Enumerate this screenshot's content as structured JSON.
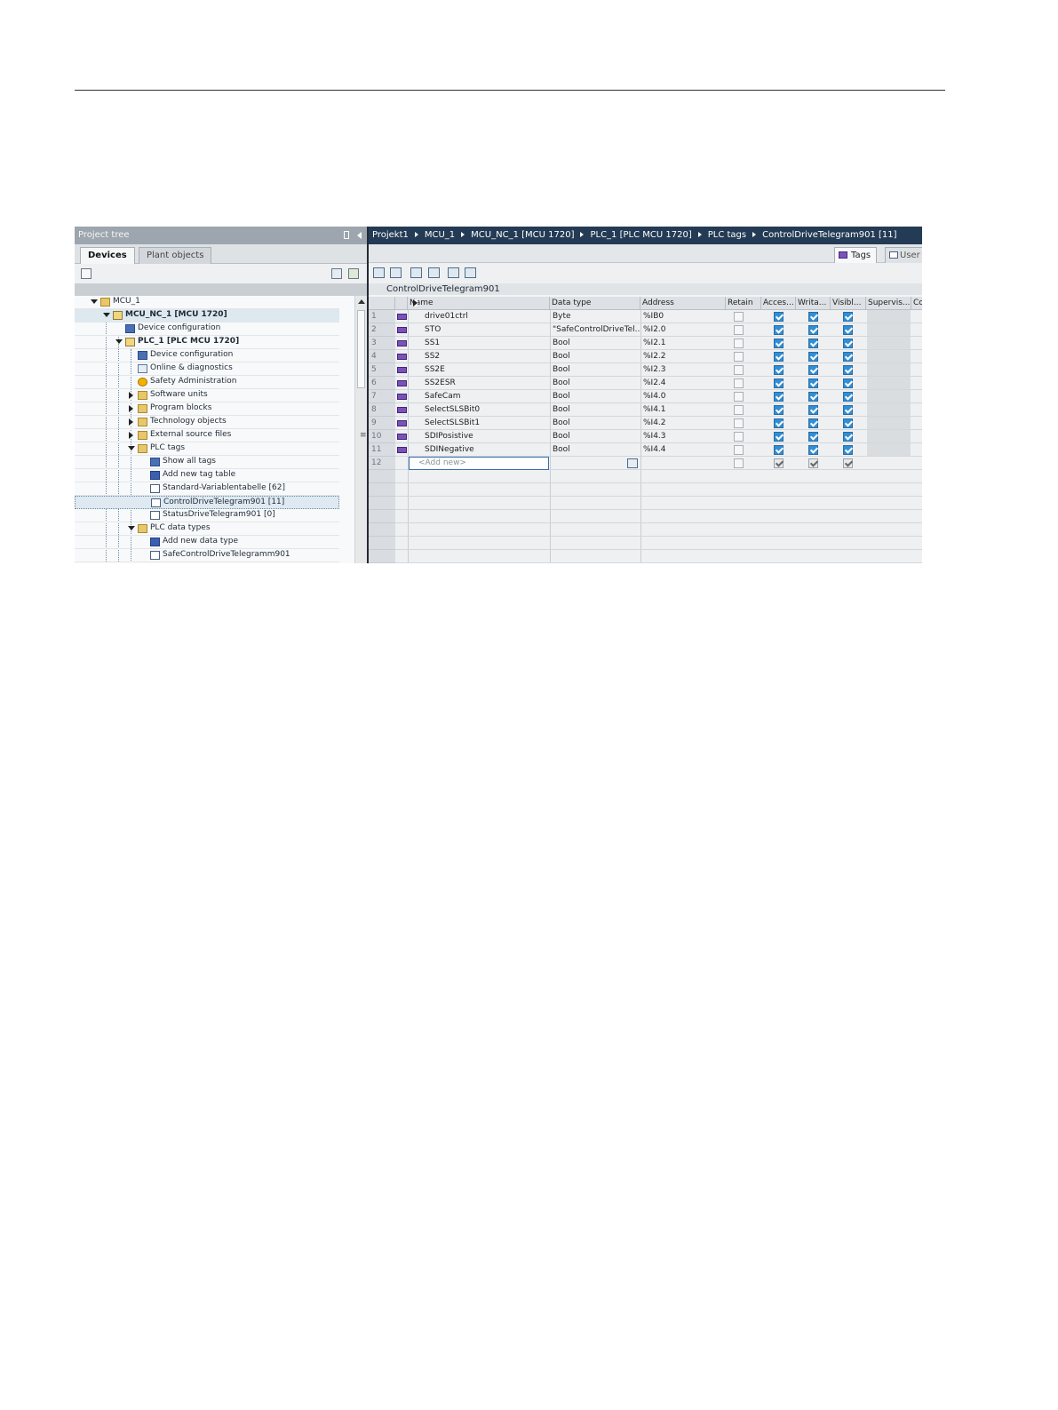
{
  "left_panel": {
    "title": "Project tree",
    "tabs": [
      "Devices",
      "Plant objects"
    ],
    "tree": [
      {
        "label": "MCU_1",
        "level": 0,
        "expander": "down",
        "icon": "folder-icon",
        "bold": false
      },
      {
        "label": "MCU_NC_1 [MCU 1720]",
        "level": 1,
        "expander": "down",
        "icon": "plc-icon",
        "bold": true
      },
      {
        "label": "Device configuration",
        "level": 2,
        "expander": "none",
        "icon": "device-config-icon",
        "bold": false
      },
      {
        "label": "PLC_1 [PLC MCU 1720]",
        "level": 2,
        "expander": "down",
        "icon": "plc-icon",
        "bold": true
      },
      {
        "label": "Device configuration",
        "level": 3,
        "expander": "none",
        "icon": "device-config-icon",
        "bold": false
      },
      {
        "label": "Online & diagnostics",
        "level": 3,
        "expander": "none",
        "icon": "diagnostics-icon",
        "bold": false
      },
      {
        "label": "Safety Administration",
        "level": 3,
        "expander": "none",
        "icon": "safety-icon",
        "bold": false
      },
      {
        "label": "Software units",
        "level": 3,
        "expander": "right",
        "icon": "folder-icon",
        "bold": false
      },
      {
        "label": "Program blocks",
        "level": 3,
        "expander": "right",
        "icon": "folder-icon",
        "bold": false
      },
      {
        "label": "Technology objects",
        "level": 3,
        "expander": "right",
        "icon": "folder-icon",
        "bold": false
      },
      {
        "label": "External source files",
        "level": 3,
        "expander": "right",
        "icon": "folder-icon",
        "bold": false
      },
      {
        "label": "PLC tags",
        "level": 3,
        "expander": "down",
        "icon": "folder-icon",
        "bold": false
      },
      {
        "label": "Show all tags",
        "level": 4,
        "expander": "none",
        "icon": "show-tags-icon",
        "bold": false
      },
      {
        "label": "Add new tag table",
        "level": 4,
        "expander": "none",
        "icon": "add-icon",
        "bold": false
      },
      {
        "label": "Standard-Variablentabelle [62]",
        "level": 4,
        "expander": "none",
        "icon": "tag-table-icon",
        "bold": false
      },
      {
        "label": "ControlDriveTelegram901 [11]",
        "level": 4,
        "expander": "none",
        "icon": "tag-table-icon",
        "bold": false
      },
      {
        "label": "StatusDriveTelegram901 [0]",
        "level": 4,
        "expander": "none",
        "icon": "tag-table-icon",
        "bold": false
      },
      {
        "label": "PLC data types",
        "level": 3,
        "expander": "down",
        "icon": "folder-icon",
        "bold": false
      },
      {
        "label": "Add new data type",
        "level": 4,
        "expander": "none",
        "icon": "add-icon",
        "bold": false
      },
      {
        "label": "SafeControlDriveTelegramm901",
        "level": 4,
        "expander": "none",
        "icon": "data-type-icon",
        "bold": false
      }
    ]
  },
  "breadcrumb": [
    "Projekt1",
    "MCU_1",
    "MCU_NC_1 [MCU 1720]",
    "PLC_1 [PLC MCU 1720]",
    "PLC tags",
    "ControlDriveTelegram901 [11]"
  ],
  "view_tabs": [
    "Tags",
    "User"
  ],
  "table": {
    "title": "ControlDriveTelegram901",
    "columns": [
      "Name",
      "Data type",
      "Address",
      "Retain",
      "Acces...",
      "Writa...",
      "Visibl...",
      "Supervis...",
      "Co"
    ],
    "rows": [
      {
        "num": "1",
        "name": "drive01ctrl",
        "type": "Byte",
        "address": "%IB0",
        "expander": false
      },
      {
        "num": "2",
        "name": "STO",
        "type": "\"SafeControlDriveTel...",
        "address": "%I2.0",
        "expander": true
      },
      {
        "num": "3",
        "name": "SS1",
        "type": "Bool",
        "address": "%I2.1",
        "expander": false
      },
      {
        "num": "4",
        "name": "SS2",
        "type": "Bool",
        "address": "%I2.2",
        "expander": false
      },
      {
        "num": "5",
        "name": "SS2E",
        "type": "Bool",
        "address": "%I2.3",
        "expander": false
      },
      {
        "num": "6",
        "name": "SS2ESR",
        "type": "Bool",
        "address": "%I2.4",
        "expander": false
      },
      {
        "num": "7",
        "name": "SafeCam",
        "type": "Bool",
        "address": "%I4.0",
        "expander": false
      },
      {
        "num": "8",
        "name": "SelectSLSBit0",
        "type": "Bool",
        "address": "%I4.1",
        "expander": false
      },
      {
        "num": "9",
        "name": "SelectSLSBit1",
        "type": "Bool",
        "address": "%I4.2",
        "expander": false
      },
      {
        "num": "10",
        "name": "SDIPosistive",
        "type": "Bool",
        "address": "%I4.3",
        "expander": false
      },
      {
        "num": "11",
        "name": "SDINegative",
        "type": "Bool",
        "address": "%I4.4",
        "expander": false
      }
    ],
    "add_new_row": {
      "num": "12",
      "placeholder": "<Add new>"
    }
  }
}
